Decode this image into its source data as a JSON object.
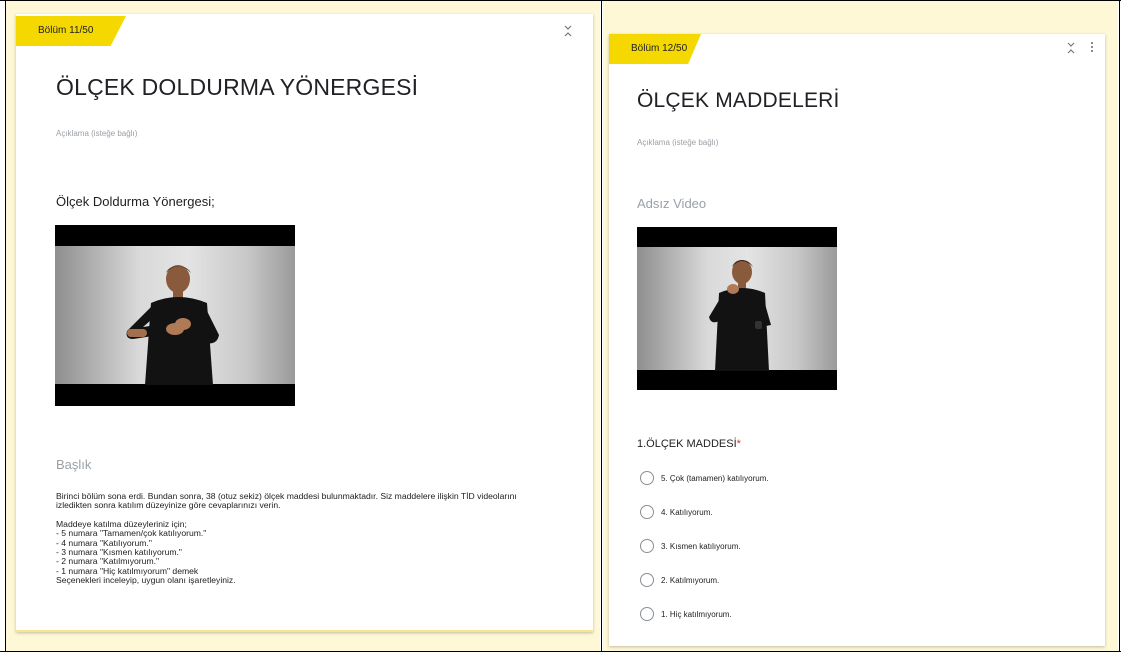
{
  "left_section": {
    "tab_label": "Bölüm 11/50",
    "title": "ÖLÇEK DOLDURMA YÖNERGESİ",
    "description_placeholder": "Açıklama (isteğe bağlı)",
    "item_title": "Ölçek Doldurma Yönergesi;",
    "text_block_title_placeholder": "Başlık",
    "body_lines": [
      "Birinci bölüm sona erdi. Bundan sonra, 38 (otuz sekiz) ölçek maddesi bulunmaktadır. Siz maddelere ilişkin TİD videolarını",
      "izledikten sonra katılım düzeyinize göre cevaplarınızı verin.",
      "",
      "Maddeye katılma düzeyleriniz için;",
      "-      5 numara \"Tamamen/çok katılıyorum.\"",
      "-      4 numara \"Katılıyorum.\"",
      "-      3 numara \"Kısmen katılıyorum.\"",
      "-      2 numara \"Katılmıyorum.\"",
      "-      1 numara \"Hiç katılmıyorum\" demek",
      "Seçenekleri inceleyip, uygun olanı işaretleyiniz."
    ]
  },
  "right_section": {
    "tab_label": "Bölüm 12/50",
    "title": "ÖLÇEK MADDELERİ",
    "description_placeholder": "Açıklama (isteğe bağlı)",
    "video_title_placeholder": "Adsız Video",
    "question_title": "1.ÖLÇEK MADDESİ",
    "required_marker": "*",
    "options": [
      "5. Çok (tamamen) katılıyorum.",
      "4. Katılıyorum.",
      "3. Kısmen katılıyorum.",
      "2. Katılmıyorum.",
      "1. Hiç katılmıyorum."
    ]
  },
  "colors": {
    "accent_yellow": "#f5d800",
    "page_background": "#fff8d6",
    "required_red": "#d93025"
  },
  "icons": [
    "collapse-icon",
    "more-vert-icon",
    "radio-circle-icon"
  ]
}
